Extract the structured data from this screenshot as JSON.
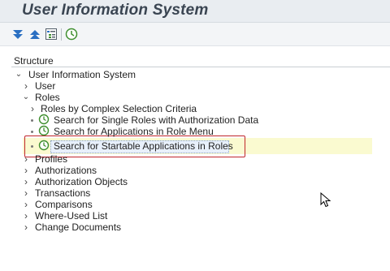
{
  "window": {
    "title": "User Information System"
  },
  "toolbar": {
    "buttons": [
      {
        "name": "expand-all-icon"
      },
      {
        "name": "collapse-all-icon"
      },
      {
        "name": "expand-subtree-icon"
      },
      {
        "name": "execute-clock-icon"
      }
    ]
  },
  "structure": {
    "label": "Structure"
  },
  "tree": {
    "root": "User Information System",
    "user": "User",
    "roles": "Roles",
    "roles_complex": "Roles by Complex Selection Criteria",
    "single_roles": "Search for Single Roles with Authorization Data",
    "apps_role_menu": "Search for Applications in Role Menu",
    "startable_apps": "Search for Startable Applications in Roles",
    "profiles": "Profiles",
    "authorizations": "Authorizations",
    "authorization_objects": "Authorization Objects",
    "transactions": "Transactions",
    "comparisons": "Comparisons",
    "where_used": "Where-Used List",
    "change_documents": "Change Documents"
  },
  "colors": {
    "selection_border": "#c0262c",
    "row_highlight": "#fafad0",
    "clock_green": "#3f8f2f"
  }
}
